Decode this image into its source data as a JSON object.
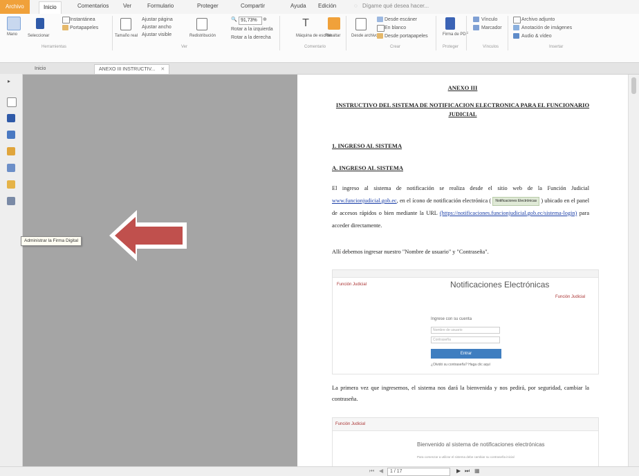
{
  "menubar": {
    "file": "Archivo",
    "items": [
      "Inicio",
      "Comentarios",
      "Ver",
      "Formulario",
      "Proteger",
      "Compartir",
      "Ayuda",
      "Edición"
    ],
    "search_placeholder": "Dígame qué desea hacer..."
  },
  "ribbon": {
    "mano": "Mano",
    "seleccionar": "Seleccionar",
    "instantanea": "Instantánea",
    "portapapeles": "Portapapeles",
    "tamano_real": "Tamaño real",
    "ajustar_pagina": "Ajustar página",
    "ajustar_ancho": "Ajustar ancho",
    "ajustar_visible": "Ajustar visible",
    "redistribucion": "Redistribución",
    "zoom_value": "91,73%",
    "rotar_izquierda": "Rotar a la izquierda",
    "rotar_derecha": "Rotar a la derecha",
    "maquina_escribir": "Máquina de escribir",
    "resaltar": "Resaltar",
    "desde_archivo": "Desde archivo",
    "desde_escaner": "Desde escáner",
    "en_blanco": "En blanco",
    "desde_portapapeles": "Desde portapapeles",
    "firma_pdf": "Firma de PDF",
    "vinculo": "Vínculo",
    "marcador": "Marcador",
    "archivo_adjunto": "Archivo adjunto",
    "anotacion_imagenes": "Anotación de imágenes",
    "audio_video": "Audio & vídeo",
    "groups": [
      "Herramientas",
      "Ver",
      "Comentario",
      "Crear",
      "Proteger",
      "Vínculos",
      "Insertar"
    ]
  },
  "tabs": [
    "Inicio",
    "ANEXO III INSTRUCTIV..."
  ],
  "tooltip": "Administrar la Firma Digital",
  "document": {
    "anexo": "ANEXO III",
    "title": "INSTRUCTIVO DEL SISTEMA DE NOTIFICACION ELECTRONICA PARA EL FUNCIONARIO JUDICIAL",
    "section1": "1.  INGRESO AL SISTEMA",
    "sectionA": "A.  INGRESO AL SISTEMA",
    "para1_a": "El ingreso al sistema de notificación se realiza desde el sitio web de la Función Judicial",
    "para1_link": "www.funcionjudicial.gob.ec",
    "para1_b": ", en el ícono de notificación electrónica (",
    "para1_icon": "Notificaciones Electrónicas",
    "para1_c": ") ubicado en el panel de accesos rápidos o bien mediante la URL",
    "url": "(https://notificaciones.funcionjudicial.gob.ec/sistema-login)",
    "para1_d": "para acceder directamente.",
    "para2": "Allí debemos ingresar nuestro \"Nombre de usuario\" y \"Contraseña\".",
    "shot1": {
      "logo": "Función Judicial",
      "heading": "Notificaciones Electrónicas",
      "logo2": "Función Judicial",
      "login_title": "Ingrese con su cuenta",
      "user_ph": "Nombre de usuario",
      "pass_ph": "Contraseña",
      "button": "Entrar",
      "forgot": "¿Olvidó su contraseña? Haga clic aquí"
    },
    "para3": "La primera vez que ingresemos, el sistema nos dará la bienvenida y nos pedirá, por seguridad, cambiar la contraseña.",
    "shot2": {
      "logo": "Función Judicial",
      "welcome": "Bienvenido al sistema de notificaciones electrónicas",
      "sub": "Para comenzar a utilizar el sistema debe cambiar su contraseña inicial"
    }
  },
  "status": {
    "page": "1 / 17"
  }
}
